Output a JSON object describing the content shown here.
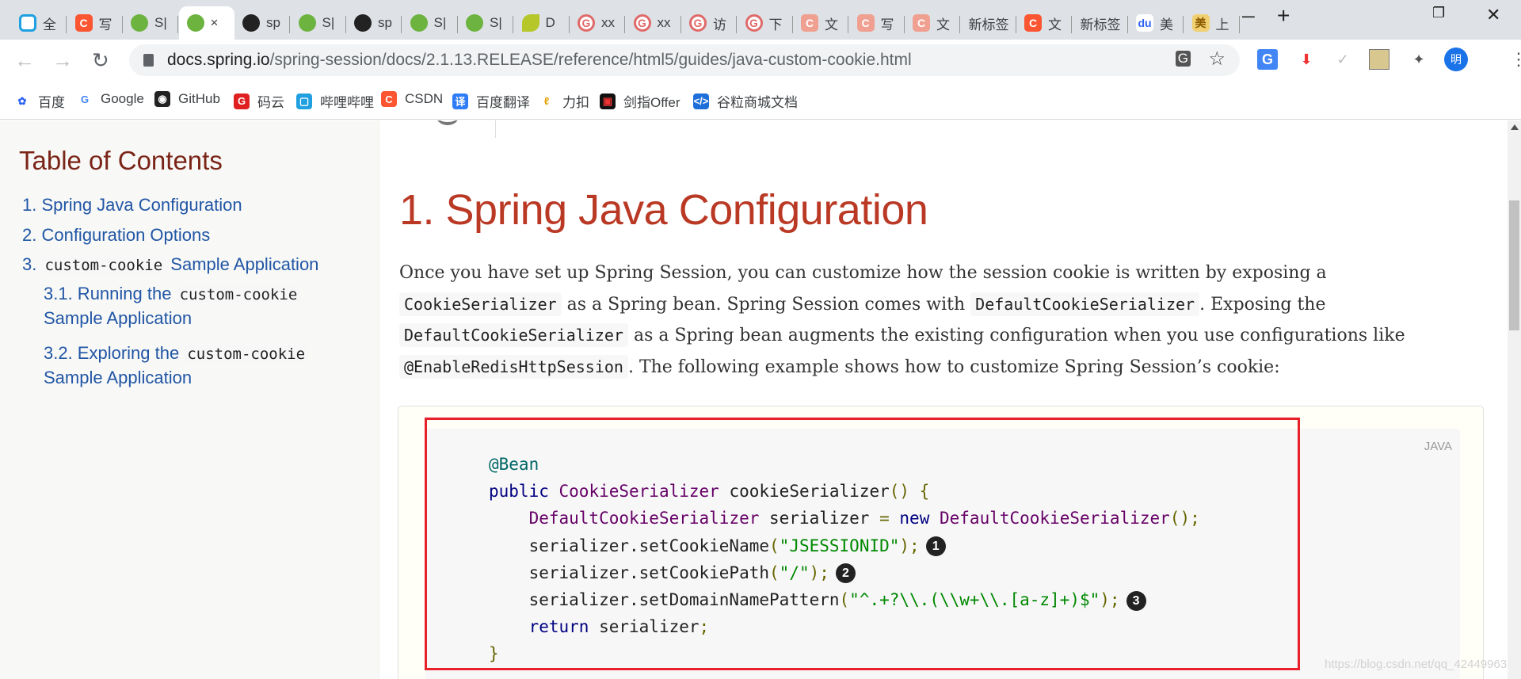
{
  "tabs": [
    {
      "icon": "bilibili-icon",
      "cls": "i-bili",
      "glyph": "",
      "label": "全"
    },
    {
      "icon": "csdn-icon",
      "cls": "i-csdn",
      "glyph": "C",
      "label": "写"
    },
    {
      "icon": "spring-icon",
      "cls": "i-spring",
      "glyph": "",
      "label": "S|"
    },
    {
      "icon": "spring-icon",
      "cls": "i-spring",
      "glyph": "",
      "label": "×",
      "active": true
    },
    {
      "icon": "github-icon",
      "cls": "i-gh",
      "glyph": "",
      "label": "sp"
    },
    {
      "icon": "spring-icon",
      "cls": "i-spring",
      "glyph": "",
      "label": "S|"
    },
    {
      "icon": "github-icon",
      "cls": "i-gh",
      "glyph": "",
      "label": "sp"
    },
    {
      "icon": "spring-icon",
      "cls": "i-spring",
      "glyph": "",
      "label": "S|"
    },
    {
      "icon": "spring-icon",
      "cls": "i-spring",
      "glyph": "",
      "label": "S|"
    },
    {
      "icon": "leaf-icon",
      "cls": "i-leaf",
      "glyph": "",
      "label": "D"
    },
    {
      "icon": "gitee-icon",
      "cls": "i-gitee",
      "glyph": "G",
      "label": "xx"
    },
    {
      "icon": "gitee-icon",
      "cls": "i-gitee",
      "glyph": "G",
      "label": "xx"
    },
    {
      "icon": "gitee-icon",
      "cls": "i-gitee",
      "glyph": "G",
      "label": "访"
    },
    {
      "icon": "gitee-icon",
      "cls": "i-gitee",
      "glyph": "G",
      "label": "下"
    },
    {
      "icon": "csdn-icon",
      "cls": "i-csdnl",
      "glyph": "C",
      "label": "文"
    },
    {
      "icon": "csdn-icon",
      "cls": "i-csdnl",
      "glyph": "C",
      "label": "写"
    },
    {
      "icon": "csdn-icon",
      "cls": "i-csdnl",
      "glyph": "C",
      "label": "文"
    },
    {
      "icon": "",
      "cls": "",
      "glyph": "",
      "label": "新标签"
    },
    {
      "icon": "csdn-icon",
      "cls": "i-csdn",
      "glyph": "C",
      "label": "文"
    },
    {
      "icon": "",
      "cls": "",
      "glyph": "",
      "label": "新标签"
    },
    {
      "icon": "baidu-icon",
      "cls": "i-baidu",
      "glyph": "du",
      "label": "美"
    },
    {
      "icon": "mei-icon",
      "cls": "i-mei",
      "glyph": "美",
      "label": "上"
    }
  ],
  "toolbar": {
    "url_host": "docs.spring.io",
    "url_path": "/spring-session/docs/2.1.13.RELEASE/reference/html5/guides/java-custom-cookie.html",
    "profile": "明"
  },
  "bookmarks": [
    {
      "label": "百度",
      "icon": "baidu-paw-icon",
      "bg": "#fff",
      "fg": "#2e62f0",
      "glyph": "✿"
    },
    {
      "label": "Google",
      "icon": "google-icon",
      "bg": "#fff",
      "fg": "#4285f4",
      "glyph": "G"
    },
    {
      "label": "GitHub",
      "icon": "github-icon",
      "bg": "#222",
      "fg": "#fff",
      "glyph": "◉"
    },
    {
      "label": "码云",
      "icon": "gitee-icon",
      "bg": "#e02020",
      "fg": "#fff",
      "glyph": "G"
    },
    {
      "label": "哔哩哔哩",
      "icon": "bilibili-icon",
      "bg": "#20a0e0",
      "fg": "#fff",
      "glyph": "▢"
    },
    {
      "label": "CSDN",
      "icon": "csdn-icon",
      "bg": "#fc5531",
      "fg": "#fff",
      "glyph": "C"
    },
    {
      "label": "百度翻译",
      "icon": "translate-icon",
      "bg": "#2e7cf6",
      "fg": "#fff",
      "glyph": "译"
    },
    {
      "label": "力扣",
      "icon": "leetcode-icon",
      "bg": "#fff",
      "fg": "#e0a000",
      "glyph": "ℓ"
    },
    {
      "label": "剑指Offer",
      "icon": "nowcoder-icon",
      "bg": "#111",
      "fg": "#e33",
      "glyph": "▣"
    },
    {
      "label": "谷粒商城文档",
      "icon": "doc-icon",
      "bg": "#1e6fd9",
      "fg": "#fff",
      "glyph": "</>"
    }
  ],
  "toc": {
    "title": "Table of Contents",
    "items": [
      {
        "prefix": "1. Spring Java Configuration",
        "code": "",
        "suffix": ""
      },
      {
        "prefix": "2. Configuration Options",
        "code": "",
        "suffix": ""
      },
      {
        "prefix": "3. ",
        "code": "custom-cookie",
        "suffix": " Sample Application"
      },
      {
        "prefix": "3.1. Running the ",
        "code": "custom-cookie",
        "suffix": "Sample Application"
      },
      {
        "prefix": "3.2. Exploring the ",
        "code": "custom-cookie",
        "suffix": "Sample Application"
      }
    ]
  },
  "content": {
    "heading": "1. Spring Java Configuration",
    "para": [
      {
        "t": "Once you have set up Spring Session, you can customize how the session cookie is written by exposing a "
      },
      {
        "c": "CookieSerializer"
      },
      {
        "t": " as a Spring bean. Spring Session comes with "
      },
      {
        "c": "DefaultCookieSerializer"
      },
      {
        "t": ". Exposing the "
      },
      {
        "c": "DefaultCookieSerializer"
      },
      {
        "t": " as a Spring bean augments the existing configuration when you use configurations like "
      },
      {
        "c": "@EnableRedisHttpSession"
      },
      {
        "t": ". The following example shows how to customize Spring Session’s cookie:"
      }
    ],
    "code_lang": "JAVA",
    "code": [
      [
        {
          "t": "@Bean",
          "c": "an"
        }
      ],
      [
        {
          "t": "public",
          "c": "kw"
        },
        {
          "t": " "
        },
        {
          "t": "CookieSerializer",
          "c": "ty"
        },
        {
          "t": " cookieSerializer"
        },
        {
          "t": "() {",
          "c": "pu"
        }
      ],
      [
        {
          "t": "    "
        },
        {
          "t": "DefaultCookieSerializer",
          "c": "ty"
        },
        {
          "t": " serializer "
        },
        {
          "t": "=",
          "c": "pu"
        },
        {
          "t": " "
        },
        {
          "t": "new",
          "c": "kw"
        },
        {
          "t": " "
        },
        {
          "t": "DefaultCookieSerializer",
          "c": "ty"
        },
        {
          "t": "();",
          "c": "pu"
        }
      ],
      [
        {
          "t": "    serializer.setCookieName"
        },
        {
          "t": "(",
          "c": "pu"
        },
        {
          "t": "\"JSESSIONID\"",
          "c": "st"
        },
        {
          "t": ");",
          "c": "pu"
        },
        {
          "callout": "1"
        }
      ],
      [
        {
          "t": "    serializer.setCookiePath"
        },
        {
          "t": "(",
          "c": "pu"
        },
        {
          "t": "\"/\"",
          "c": "st"
        },
        {
          "t": ");",
          "c": "pu"
        },
        {
          "callout": "2"
        }
      ],
      [
        {
          "t": "    serializer.setDomainNamePattern"
        },
        {
          "t": "(",
          "c": "pu"
        },
        {
          "t": "\"^.+?\\\\.(\\\\w+\\\\.[a-z]+)$\"",
          "c": "st"
        },
        {
          "t": ");",
          "c": "pu"
        },
        {
          "callout": "3"
        }
      ],
      [
        {
          "t": "    "
        },
        {
          "t": "return",
          "c": "kw"
        },
        {
          "t": " serializer"
        },
        {
          "t": ";",
          "c": "pu"
        }
      ],
      [
        {
          "t": "}",
          "c": "pu"
        }
      ]
    ]
  },
  "watermark": "https://blog.csdn.net/qq_42449963",
  "colors": {
    "heading": "#ba3925",
    "toc_link": "#2156a5",
    "highlight_box": "#e8202a"
  }
}
